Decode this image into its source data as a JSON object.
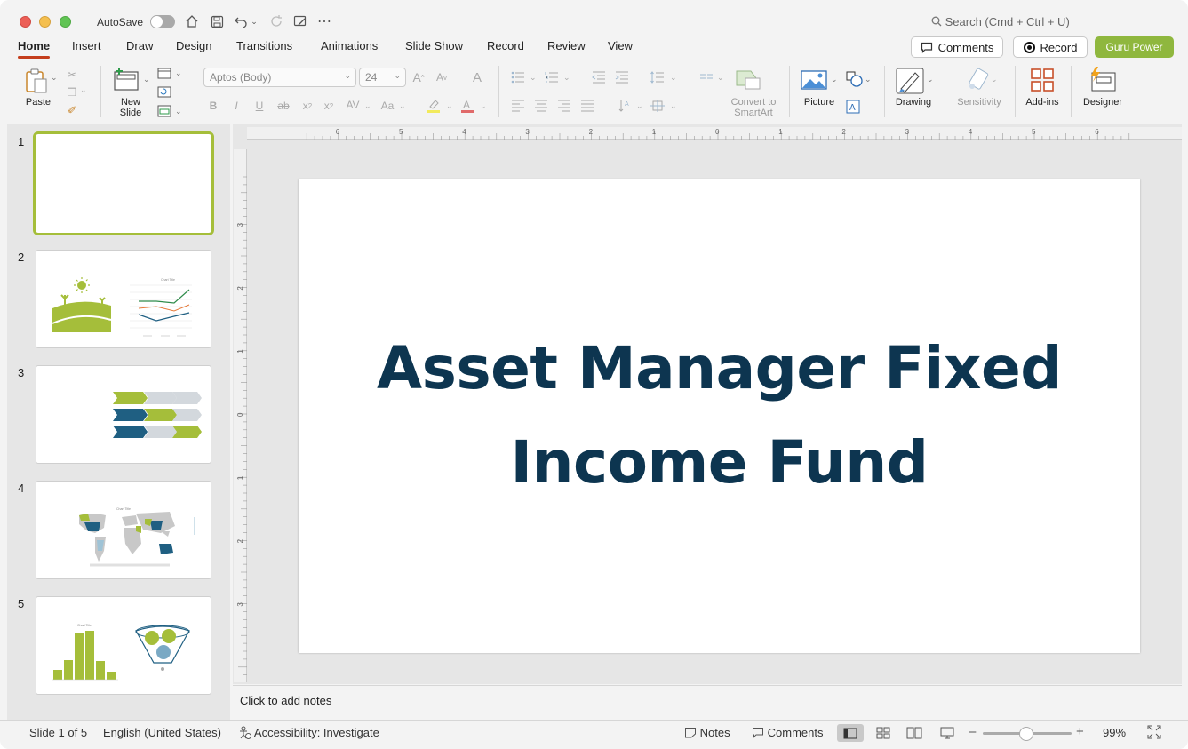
{
  "titlebar": {
    "autosave_label": "AutoSave",
    "search_placeholder": "Search (Cmd + Ctrl + U)"
  },
  "tabs": [
    "Home",
    "Insert",
    "Draw",
    "Design",
    "Transitions",
    "Animations",
    "Slide Show",
    "Record",
    "Review",
    "View"
  ],
  "actions": {
    "comments": "Comments",
    "record": "Record",
    "guru": "Guru Power"
  },
  "ribbon": {
    "paste": "Paste",
    "new_slide_line1": "New",
    "new_slide_line2": "Slide",
    "font_name": "Aptos (Body)",
    "font_size": "24",
    "convert_line1": "Convert to",
    "convert_line2": "SmartArt",
    "picture": "Picture",
    "drawing": "Drawing",
    "sensitivity": "Sensitivity",
    "addins": "Add-ins",
    "designer": "Designer"
  },
  "ruler": {
    "h": [
      "6",
      "5",
      "4",
      "3",
      "2",
      "1",
      "0",
      "1",
      "2",
      "3",
      "4",
      "5",
      "6"
    ],
    "v": [
      "3",
      "2",
      "1",
      "0",
      "1",
      "2",
      "3"
    ]
  },
  "thumbnails": {
    "numbers": [
      "1",
      "2",
      "3",
      "4",
      "5"
    ],
    "chart_title": "Chart Title"
  },
  "slide": {
    "title_line1": "Asset Manager Fixed",
    "title_line2": "Income Fund"
  },
  "notes_placeholder": "Click to add notes",
  "status": {
    "slide_pos": "Slide 1 of 5",
    "language": "English (United States)",
    "accessibility": "Accessibility: Investigate",
    "notes": "Notes",
    "comments": "Comments",
    "zoom": "99%"
  },
  "colors": {
    "accent": "#c43e1c",
    "brand_green": "#8fb73e",
    "title_navy": "#0d3550",
    "series_blue": "#1f5f82"
  }
}
